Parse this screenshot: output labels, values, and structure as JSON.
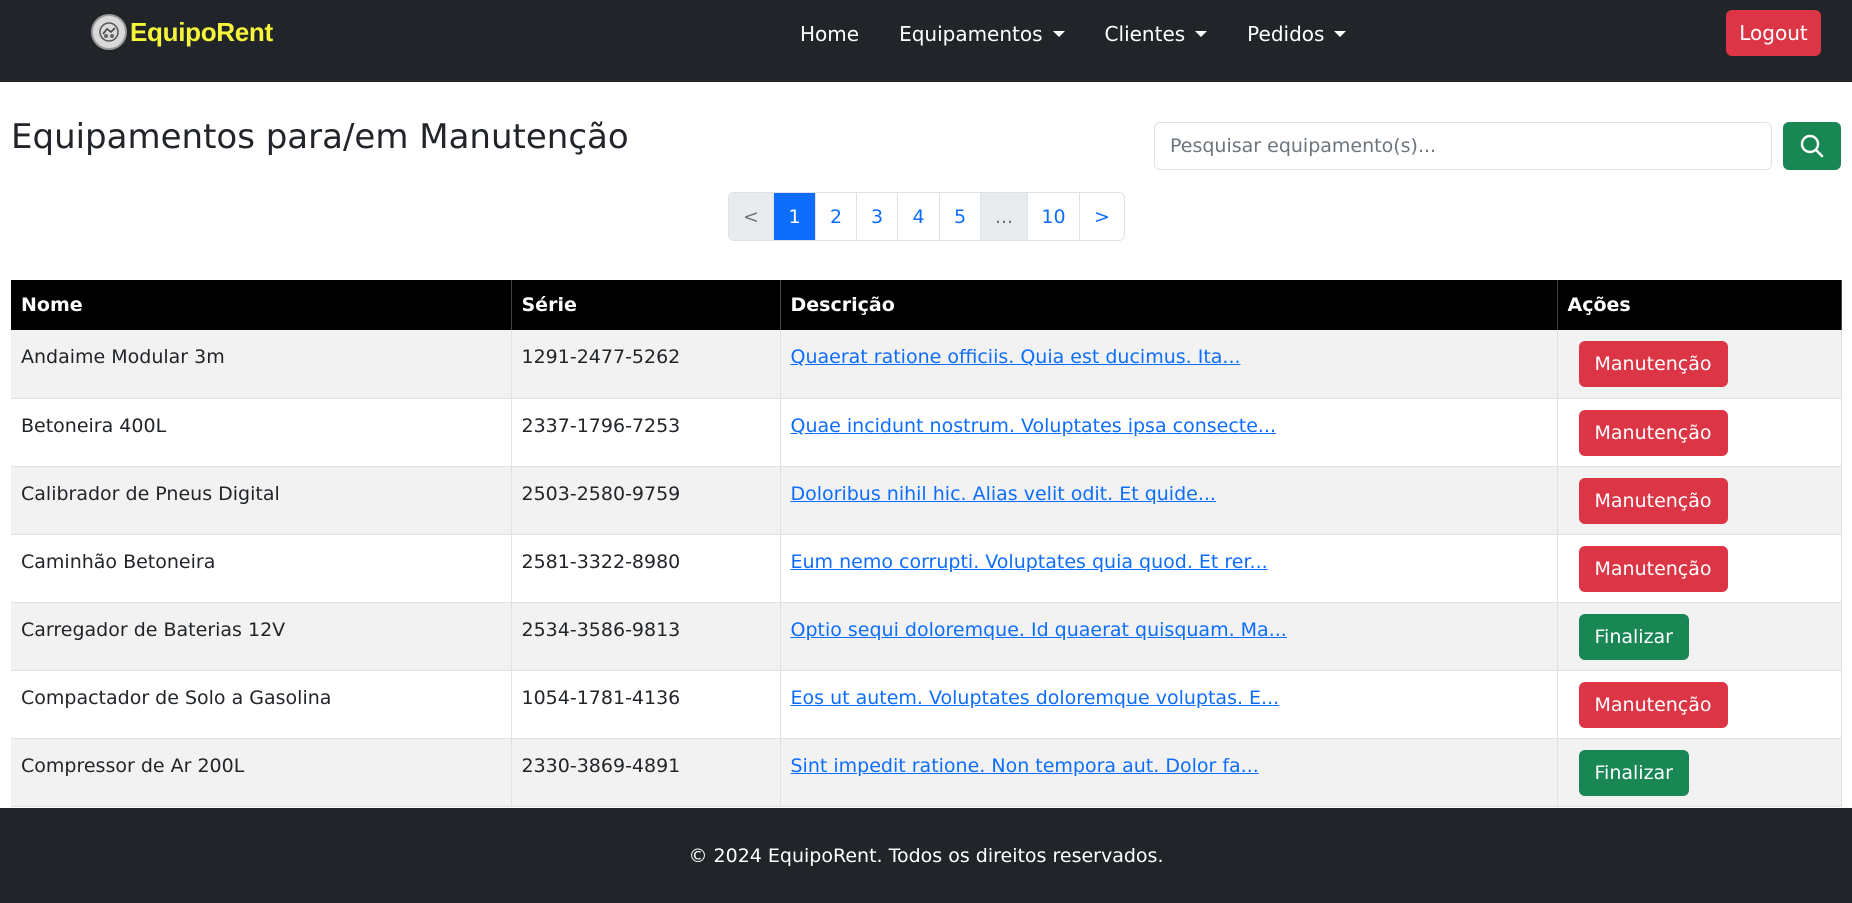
{
  "nav": {
    "brand": "EquipoRent",
    "items": [
      {
        "label": "Home",
        "dropdown": false
      },
      {
        "label": "Equipamentos",
        "dropdown": true
      },
      {
        "label": "Clientes",
        "dropdown": true
      },
      {
        "label": "Pedidos",
        "dropdown": true
      }
    ],
    "logout_label": "Logout"
  },
  "page": {
    "title": "Equipamentos para/em Manutenção",
    "search_placeholder": "Pesquisar equipamento(s)..."
  },
  "pagination": {
    "items": [
      {
        "label": "<",
        "state": "disabled"
      },
      {
        "label": "1",
        "state": "active"
      },
      {
        "label": "2",
        "state": "normal"
      },
      {
        "label": "3",
        "state": "normal"
      },
      {
        "label": "4",
        "state": "normal"
      },
      {
        "label": "5",
        "state": "normal"
      },
      {
        "label": "...",
        "state": "disabled"
      },
      {
        "label": "10",
        "state": "normal"
      },
      {
        "label": ">",
        "state": "normal"
      }
    ]
  },
  "table": {
    "headers": [
      "Nome",
      "Série",
      "Descrição",
      "Ações"
    ],
    "rows": [
      {
        "nome": "Andaime Modular 3m",
        "serie": "1291-2477-5262",
        "descricao": "Quaerat ratione officiis. Quia est ducimus. Ita...",
        "acao": "Manutenção"
      },
      {
        "nome": "Betoneira 400L",
        "serie": "2337-1796-7253",
        "descricao": "Quae incidunt nostrum. Voluptates ipsa consecte...",
        "acao": "Manutenção"
      },
      {
        "nome": "Calibrador de Pneus Digital",
        "serie": "2503-2580-9759",
        "descricao": "Doloribus nihil hic. Alias velit odit. Et quide...",
        "acao": "Manutenção"
      },
      {
        "nome": "Caminhão Betoneira",
        "serie": "2581-3322-8980",
        "descricao": "Eum nemo corrupti. Voluptates quia quod. Et rer...",
        "acao": "Manutenção"
      },
      {
        "nome": "Carregador de Baterias 12V",
        "serie": "2534-3586-9813",
        "descricao": "Optio sequi doloremque. Id quaerat quisquam. Ma...",
        "acao": "Finalizar"
      },
      {
        "nome": "Compactador de Solo a Gasolina",
        "serie": "1054-1781-4136",
        "descricao": "Eos ut autem. Voluptates doloremque voluptas. E...",
        "acao": "Manutenção"
      },
      {
        "nome": "Compressor de Ar 200L",
        "serie": "2330-3869-4891",
        "descricao": "Sint impedit ratione. Non tempora aut. Dolor fa...",
        "acao": "Finalizar"
      }
    ]
  },
  "footer": {
    "text": "© 2024 EquipoRent. Todos os direitos reservados."
  }
}
